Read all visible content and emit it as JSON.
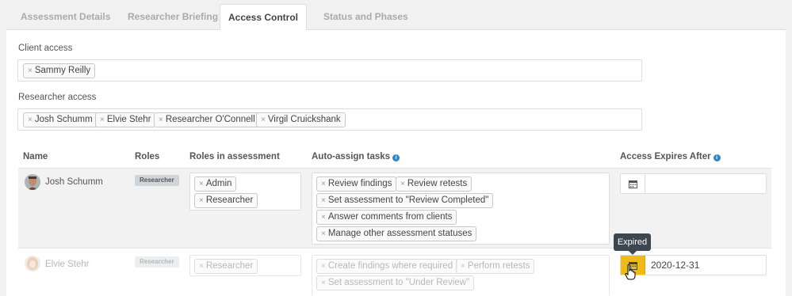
{
  "tabs": [
    {
      "label": "Assessment Details"
    },
    {
      "label": "Researcher Briefing"
    },
    {
      "label": "Access Control"
    },
    {
      "label": "Status and Phases"
    }
  ],
  "active_tab": "Access Control",
  "client_access": {
    "label": "Client access",
    "tags": [
      "Sammy Reilly"
    ]
  },
  "researcher_access": {
    "label": "Researcher access",
    "tags": [
      "Josh Schumm",
      "Elvie Stehr",
      "Researcher O'Connell",
      "Virgil Cruickshank"
    ]
  },
  "tag_remove_glyph": "×",
  "table": {
    "headers": {
      "name": "Name",
      "roles": "Roles",
      "roles_in_assessment": "Roles in assessment",
      "auto_assign": "Auto-assign tasks",
      "access_expires": "Access Expires After"
    },
    "info_glyph": "i",
    "rows": [
      {
        "name": "Josh Schumm",
        "role": "Researcher",
        "roles_in_assessment": [
          "Admin",
          "Researcher"
        ],
        "tasks": [
          "Review findings",
          "Review retests",
          "Set assessment to \"Review Completed\"",
          "Answer comments from clients",
          "Manage other assessment statuses"
        ],
        "expires": ""
      },
      {
        "name": "Elvie Stehr",
        "role": "Researcher",
        "roles_in_assessment": [
          "Researcher"
        ],
        "tasks": [
          "Create findings where required",
          "Perform retests",
          "Set assessment to \"Under Review\""
        ],
        "expires": "2020-12-31"
      }
    ]
  },
  "tooltip": "Expired",
  "colors": {
    "accent_warning": "#f0bb16",
    "info": "#2f86c8",
    "tooltip_bg": "#3c4750"
  }
}
